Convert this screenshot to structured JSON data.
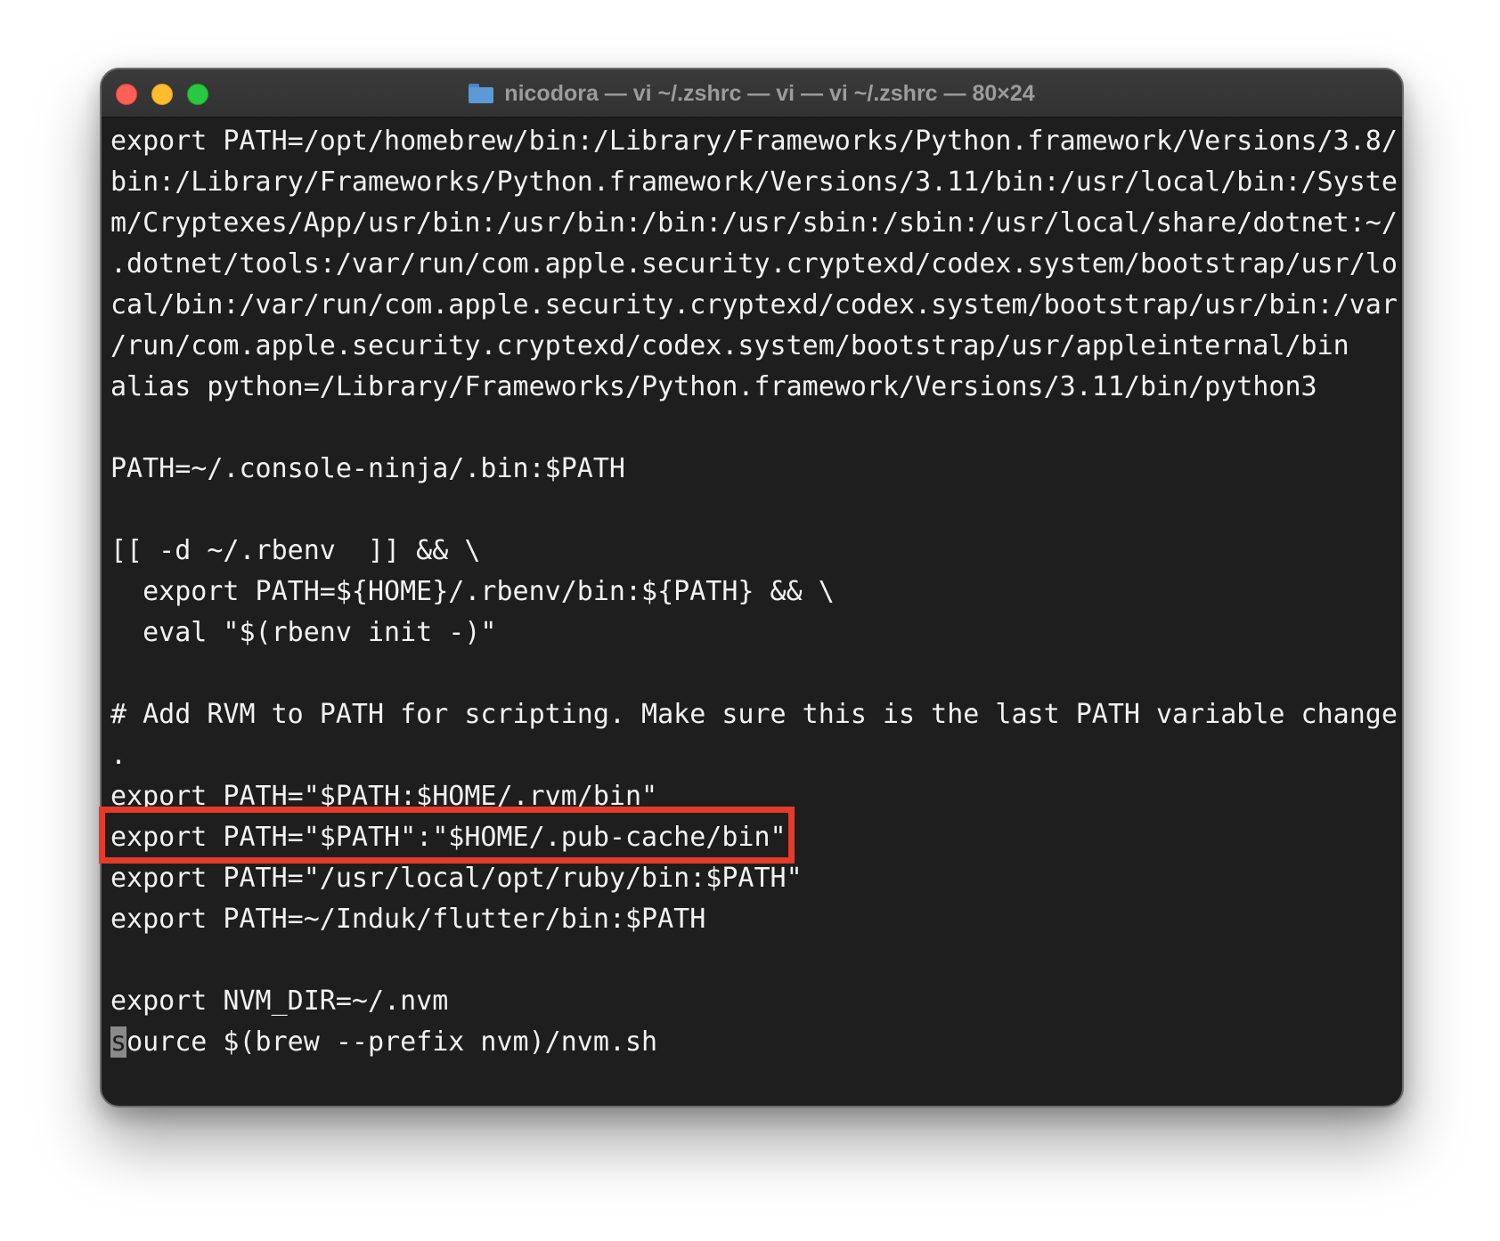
{
  "window": {
    "title": "nicodora — vi ~/.zshrc — vi — vi ~/.zshrc — 80×24",
    "folder_icon": "folder-icon"
  },
  "colors": {
    "background": "#1e1e1e",
    "text": "#f2f2f2",
    "highlight_border": "#e53b2a",
    "close": "#fe5f57",
    "minimize": "#febc2e",
    "zoom": "#28c840"
  },
  "editor": {
    "lines": [
      "export PATH=/opt/homebrew/bin:/Library/Frameworks/Python.framework/Versions/3.8/",
      "bin:/Library/Frameworks/Python.framework/Versions/3.11/bin:/usr/local/bin:/Syste",
      "m/Cryptexes/App/usr/bin:/usr/bin:/bin:/usr/sbin:/sbin:/usr/local/share/dotnet:~/",
      ".dotnet/tools:/var/run/com.apple.security.cryptexd/codex.system/bootstrap/usr/lo",
      "cal/bin:/var/run/com.apple.security.cryptexd/codex.system/bootstrap/usr/bin:/var",
      "/run/com.apple.security.cryptexd/codex.system/bootstrap/usr/appleinternal/bin",
      "alias python=/Library/Frameworks/Python.framework/Versions/3.11/bin/python3",
      "",
      "PATH=~/.console-ninja/.bin:$PATH",
      "",
      "[[ -d ~/.rbenv  ]] && \\",
      "  export PATH=${HOME}/.rbenv/bin:${PATH} && \\",
      "  eval \"$(rbenv init -)\"",
      "",
      "# Add RVM to PATH for scripting. Make sure this is the last PATH variable change",
      ".",
      "export PATH=\"$PATH:$HOME/.rvm/bin\"",
      "export PATH=\"$PATH\":\"$HOME/.pub-cache/bin\"",
      "export PATH=\"/usr/local/opt/ruby/bin:$PATH\"",
      "export PATH=~/Induk/flutter/bin:$PATH",
      "",
      "export NVM_DIR=~/.nvm"
    ],
    "last_line": {
      "cursor_char": "s",
      "rest": "ource $(brew --prefix nvm)/nvm.sh"
    }
  }
}
